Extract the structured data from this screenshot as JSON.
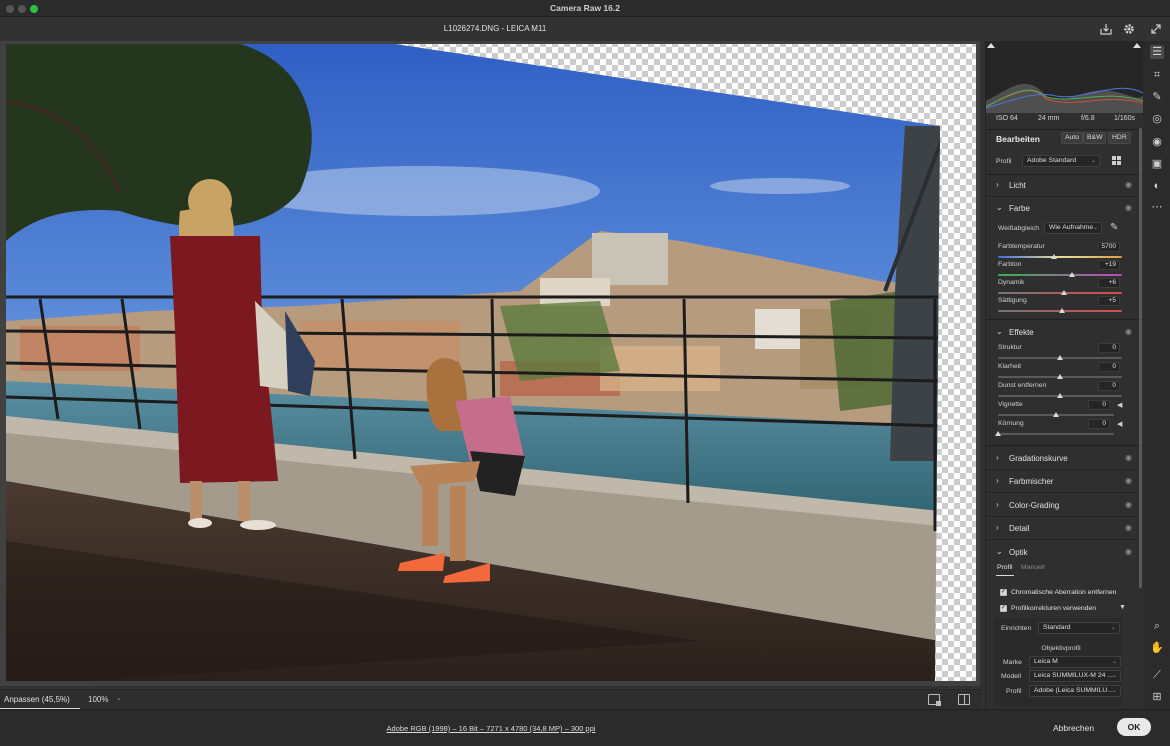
{
  "window": {
    "title": "Camera Raw 16.2",
    "file": "L1026274.DNG  -  LEICA M11"
  },
  "toolbar": {
    "save_icon": "save-download-icon",
    "settings_icon": "gear-icon",
    "fullscreen_icon": "expand-icon"
  },
  "histogram": {
    "iso": "ISO 64",
    "focal": "24 mm",
    "aperture": "f/6.8",
    "shutter": "1/160s"
  },
  "edit": {
    "heading": "Bearbeiten",
    "auto": "Auto",
    "bw": "B&W",
    "hdr": "HDR",
    "profile_label": "Profil",
    "profile_value": "Adobe Standard"
  },
  "sections": {
    "licht": "Licht",
    "farbe": "Farbe",
    "effekte": "Effekte",
    "gradation": "Gradationskurve",
    "farbmischer": "Farbmischer",
    "colorgrading": "Color-Grading",
    "detail": "Detail",
    "optik": "Optik"
  },
  "farbe": {
    "wb_label": "Weißabgleich",
    "wb_value": "Wie Aufnahme",
    "sliders": [
      {
        "label": "Farbtemperatur",
        "value": "5700",
        "pos": 0.45
      },
      {
        "label": "Farbton",
        "value": "+19",
        "pos": 0.6
      },
      {
        "label": "Dynamik",
        "value": "+6",
        "pos": 0.53
      },
      {
        "label": "Sättigung",
        "value": "+5",
        "pos": 0.52
      }
    ]
  },
  "effekte": {
    "sliders": [
      {
        "label": "Struktur",
        "value": "0",
        "pos": 0.5
      },
      {
        "label": "Klarheit",
        "value": "0",
        "pos": 0.5
      },
      {
        "label": "Dunst entfernen",
        "value": "0",
        "pos": 0.5
      },
      {
        "label": "Vignette",
        "value": "0",
        "pos": 0.5
      },
      {
        "label": "Körnung",
        "value": "0",
        "pos": 0.0
      }
    ]
  },
  "optik": {
    "tab_profile": "Profil",
    "tab_manual": "Manuell",
    "chromatic": "Chromatische Aberration entfernen",
    "profile_corr": "Profilkorrekturen verwenden",
    "setup_label": "Einrichten",
    "setup_value": "Standard",
    "lens_heading": "Objektivprofil",
    "make_label": "Marke",
    "make_value": "Leica M",
    "model_label": "Modell",
    "model_value": "Leica SUMMILUX-M 24 ...",
    "profile_label": "Profil",
    "profile_value": "Adobe (Leica SUMMILU..."
  },
  "bottombar": {
    "fit": "Anpassen (45,5%)",
    "zoom": "100%"
  },
  "footer": {
    "workflow": "Adobe RGB (1998) – 16 Bit – 7271 x 4780 (34,8 MP) – 300 ppi",
    "cancel": "Abbrechen",
    "ok": "OK"
  },
  "colors": {
    "accent": "#e9e9e9",
    "panel": "#2f2f2f",
    "sky": "#3d6dc8",
    "dress": "#8a1b20"
  }
}
